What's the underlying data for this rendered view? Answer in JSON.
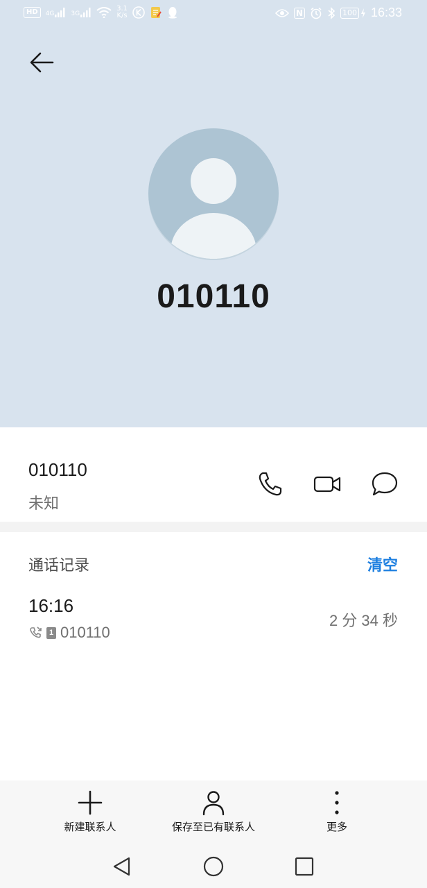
{
  "status_bar": {
    "hd_label": "HD",
    "signal_1_label": "4G",
    "signal_2_label": "3G",
    "net_speed_value": "3.1",
    "net_speed_unit": "K/s",
    "nfc_label": "N",
    "battery_label": "100",
    "time": "16:33"
  },
  "header": {
    "number": "010110"
  },
  "contact": {
    "number": "010110",
    "location": "未知"
  },
  "call_log": {
    "title": "通话记录",
    "clear_label": "清空",
    "entries": [
      {
        "time": "16:16",
        "sim": "1",
        "number": "010110",
        "duration": "2 分 34 秒"
      }
    ]
  },
  "toolbar": {
    "new_contact_label": "新建联系人",
    "save_existing_label": "保存至已有联系人",
    "more_label": "更多"
  }
}
